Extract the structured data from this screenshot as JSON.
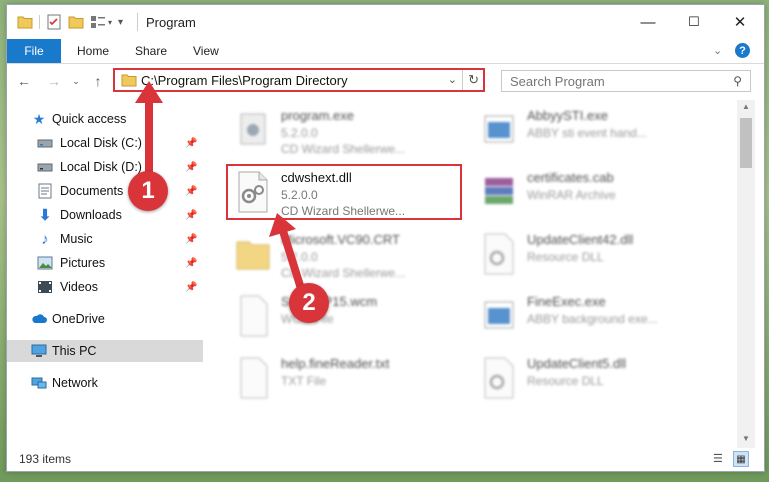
{
  "window": {
    "title": "Program",
    "controls": {
      "minimize": "—",
      "maximize": "☐",
      "close": "✕"
    }
  },
  "ribbon": {
    "tabs": [
      "File",
      "Home",
      "Share",
      "View"
    ]
  },
  "address": {
    "path": "C:\\Program Files\\Program Directory"
  },
  "search": {
    "placeholder": "Search Program"
  },
  "sidebar": {
    "items": [
      {
        "label": "Quick access",
        "icon": "star-icon",
        "pinned": false
      },
      {
        "label": "Local Disk (C:)",
        "icon": "drive-icon",
        "pinned": true
      },
      {
        "label": "Local Disk (D:)",
        "icon": "drive-icon",
        "pinned": true
      },
      {
        "label": "Documents",
        "icon": "documents-icon",
        "pinned": true
      },
      {
        "label": "Downloads",
        "icon": "download-icon",
        "pinned": true
      },
      {
        "label": "Music",
        "icon": "music-icon",
        "pinned": true
      },
      {
        "label": "Pictures",
        "icon": "pictures-icon",
        "pinned": true
      },
      {
        "label": "Videos",
        "icon": "videos-icon",
        "pinned": true
      },
      {
        "label": "OneDrive",
        "icon": "cloud-icon",
        "pinned": false
      },
      {
        "label": "This PC",
        "icon": "computer-icon",
        "pinned": false
      },
      {
        "label": "Network",
        "icon": "network-icon",
        "pinned": false
      }
    ]
  },
  "files": [
    {
      "name": "program.exe",
      "version": "5.2.0.0",
      "desc": "CD Wizard Shellerwe..."
    },
    {
      "name": "AbbyySTI.exe",
      "version": "ABBY sti event hand...",
      "desc": ""
    },
    {
      "name": "cdwshext.dll",
      "version": "5.2.0.0",
      "desc": "CD Wizard Shellerwe..."
    },
    {
      "name": "certificates.cab",
      "version": "WinRAR Archive",
      "desc": ""
    },
    {
      "name": "Microsoft.VC90.CRT",
      "version": "5.2.0.0",
      "desc": "CD Wizard Shellerwe..."
    },
    {
      "name": "UpdateClient42.dll",
      "version": "Resource DLL",
      "desc": ""
    },
    {
      "name": "SnapWP15.wcm",
      "version": "WCM File",
      "desc": ""
    },
    {
      "name": "FineExec.exe",
      "version": "ABBY background exe...",
      "desc": ""
    },
    {
      "name": "help.fineReader.txt",
      "version": "TXT File",
      "desc": ""
    },
    {
      "name": "UpdateClient5.dll",
      "version": "Resource DLL",
      "desc": ""
    }
  ],
  "status": {
    "count": "193 items"
  },
  "annotations": {
    "step1": "1",
    "step2": "2",
    "color": "#d9343a"
  }
}
